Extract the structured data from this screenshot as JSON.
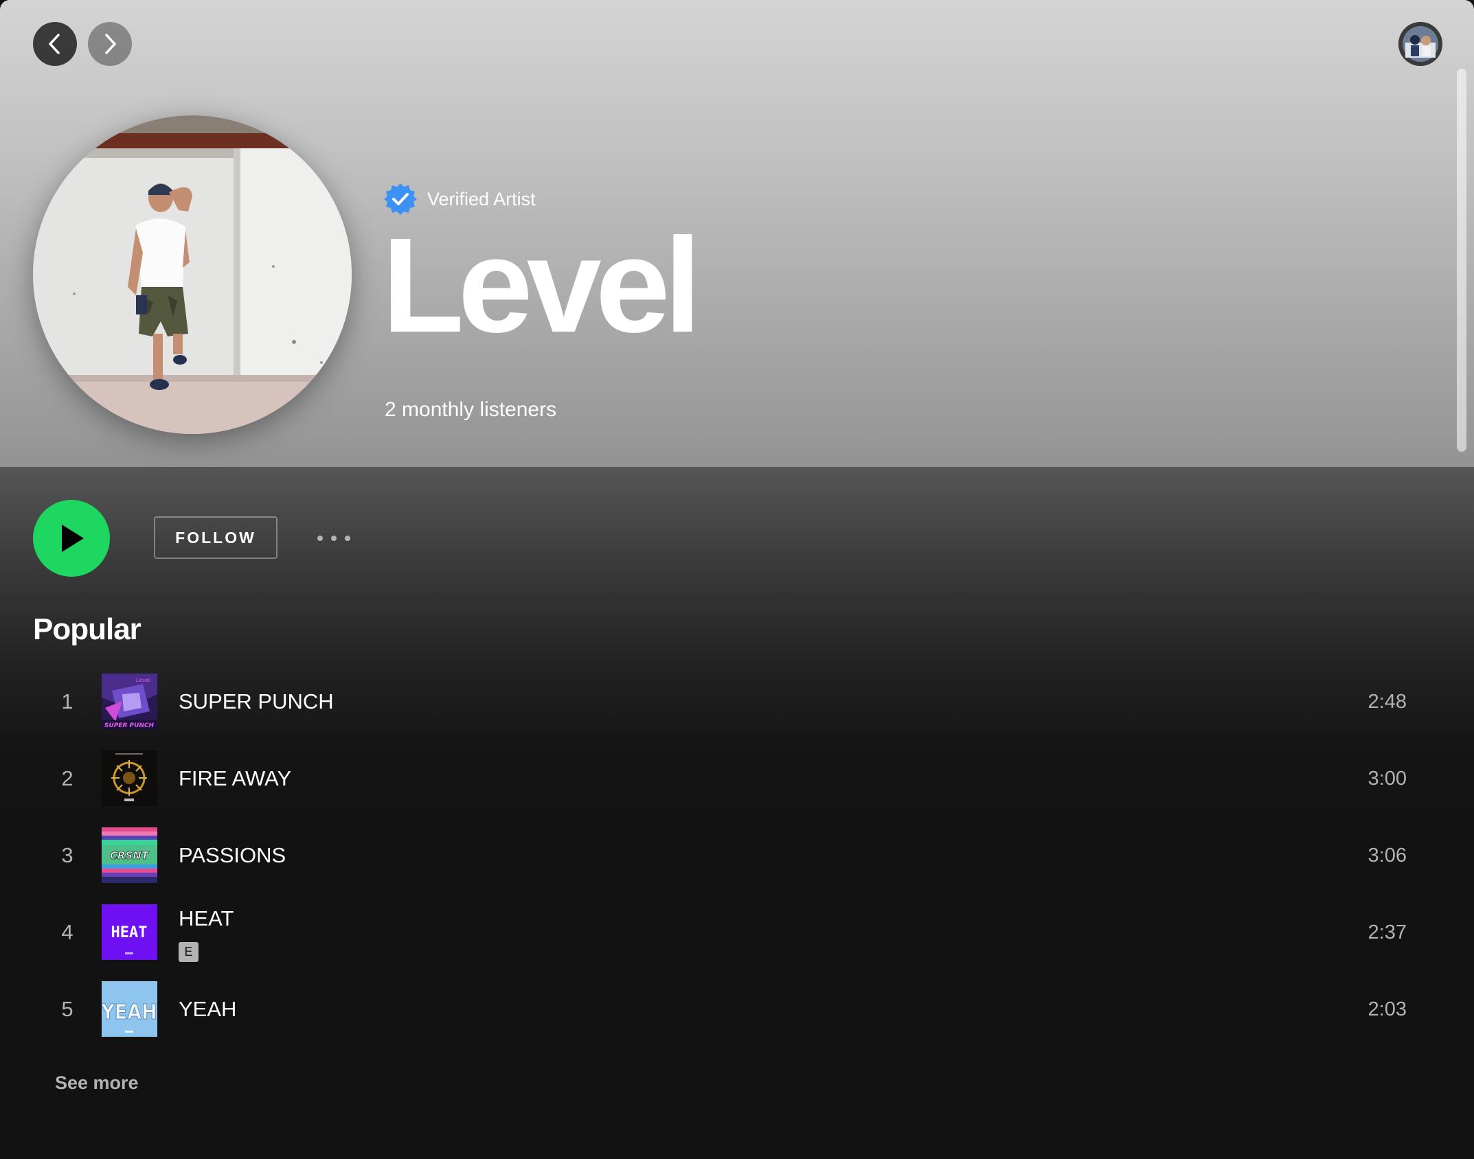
{
  "header": {
    "verified_label": "Verified Artist",
    "artist_name": "Level",
    "monthly_listeners": "2 monthly listeners"
  },
  "actions": {
    "follow_label": "FOLLOW"
  },
  "popular": {
    "title": "Popular",
    "see_more_label": "See more",
    "tracks": [
      {
        "number": "1",
        "title": "SUPER PUNCH",
        "duration": "2:48",
        "explicit": false,
        "cover_icon": "super-punch-cover"
      },
      {
        "number": "2",
        "title": "FIRE AWAY",
        "duration": "3:00",
        "explicit": false,
        "cover_icon": "fire-away-cover"
      },
      {
        "number": "3",
        "title": "PASSIONS",
        "duration": "3:06",
        "explicit": false,
        "cover_icon": "passions-cover"
      },
      {
        "number": "4",
        "title": "HEAT",
        "duration": "2:37",
        "explicit": true,
        "explicit_label": "E",
        "cover_icon": "heat-cover",
        "cover_text": "HEAT"
      },
      {
        "number": "5",
        "title": "YEAH",
        "duration": "2:03",
        "explicit": false,
        "cover_icon": "yeah-cover",
        "cover_text": "YEAH"
      }
    ]
  },
  "colors": {
    "accent_green": "#1ed760",
    "verified_blue": "#3d91f4",
    "background": "#121212",
    "secondary_text": "#b3b3b3"
  }
}
